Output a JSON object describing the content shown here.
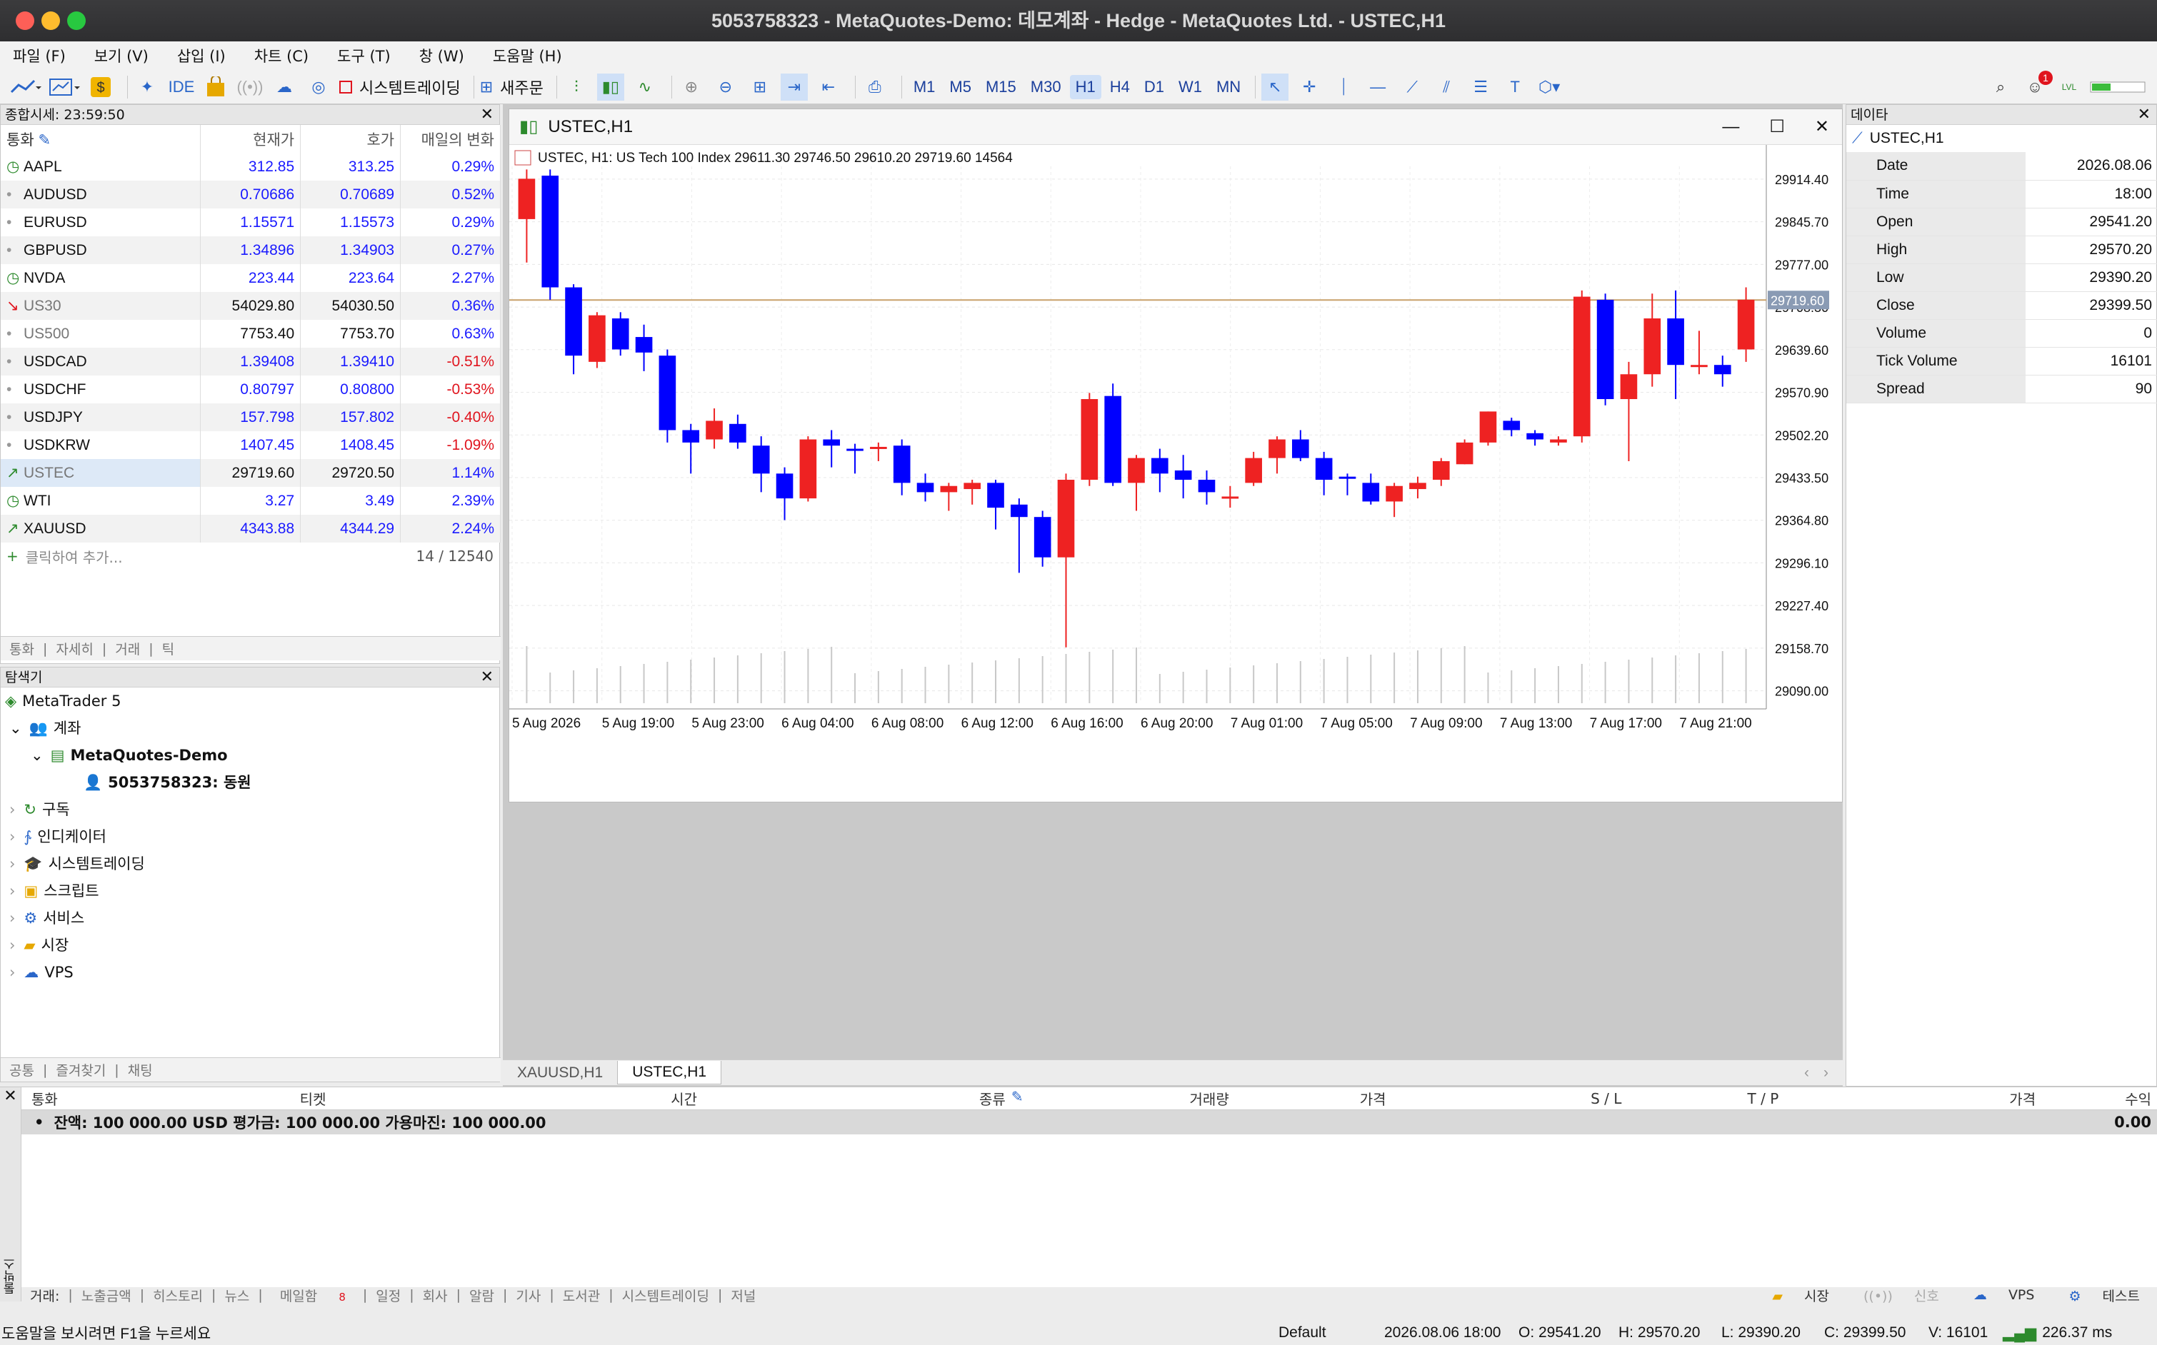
{
  "title": "5053758323 - MetaQuotes-Demo: 데모계좌 - Hedge - MetaQuotes Ltd. - USTEC,H1",
  "menu": [
    "파일 (F)",
    "보기 (V)",
    "삽입 (I)",
    "차트 (C)",
    "도구 (T)",
    "창 (W)",
    "도움말 (H)"
  ],
  "toolbar": {
    "algo": "시스템트레이딩",
    "new_order": "새주문",
    "ide": "IDE",
    "timeframes": [
      "M1",
      "M5",
      "M15",
      "M30",
      "H1",
      "H4",
      "D1",
      "W1",
      "MN"
    ],
    "active_tf": "H1",
    "badge": "1",
    "lvl": "LVL"
  },
  "market_watch": {
    "title": "종합시세: 23:59:50",
    "cols": [
      "통화",
      "현재가",
      "호가",
      "매일의 변화"
    ],
    "rows": [
      {
        "sym": "AAPL",
        "bid": "312.85",
        "ask": "313.25",
        "chg": "0.29%",
        "neg": false,
        "icon": "clock-icon",
        "dim": false
      },
      {
        "sym": "AUDUSD",
        "bid": "0.70686",
        "ask": "0.70689",
        "chg": "0.52%",
        "neg": false,
        "icon": "dot-icon",
        "dim": false
      },
      {
        "sym": "EURUSD",
        "bid": "1.15571",
        "ask": "1.15573",
        "chg": "0.29%",
        "neg": false,
        "icon": "dot-icon",
        "dim": false
      },
      {
        "sym": "GBPUSD",
        "bid": "1.34896",
        "ask": "1.34903",
        "chg": "0.27%",
        "neg": false,
        "icon": "dot-icon",
        "dim": false
      },
      {
        "sym": "NVDA",
        "bid": "223.44",
        "ask": "223.64",
        "chg": "2.27%",
        "neg": false,
        "icon": "clock-icon",
        "dim": false
      },
      {
        "sym": "US30",
        "bid": "54029.80",
        "ask": "54030.50",
        "chg": "0.36%",
        "neg": false,
        "icon": "arrow-down-icon",
        "dim": true
      },
      {
        "sym": "US500",
        "bid": "7753.40",
        "ask": "7753.70",
        "chg": "0.63%",
        "neg": false,
        "icon": "dot-icon",
        "dim": true
      },
      {
        "sym": "USDCAD",
        "bid": "1.39408",
        "ask": "1.39410",
        "chg": "-0.51%",
        "neg": true,
        "icon": "dot-icon",
        "dim": false
      },
      {
        "sym": "USDCHF",
        "bid": "0.80797",
        "ask": "0.80800",
        "chg": "-0.53%",
        "neg": true,
        "icon": "dot-icon",
        "dim": false
      },
      {
        "sym": "USDJPY",
        "bid": "157.798",
        "ask": "157.802",
        "chg": "-0.40%",
        "neg": true,
        "icon": "dot-icon",
        "dim": false
      },
      {
        "sym": "USDKRW",
        "bid": "1407.45",
        "ask": "1408.45",
        "chg": "-1.09%",
        "neg": true,
        "icon": "dot-icon",
        "dim": false
      },
      {
        "sym": "USTEC",
        "bid": "29719.60",
        "ask": "29720.50",
        "chg": "1.14%",
        "neg": false,
        "icon": "arrow-up-icon",
        "dim": true
      },
      {
        "sym": "WTI",
        "bid": "3.27",
        "ask": "3.49",
        "chg": "2.39%",
        "neg": false,
        "icon": "clock-icon",
        "dim": false
      },
      {
        "sym": "XAUUSD",
        "bid": "4343.88",
        "ask": "4344.29",
        "chg": "2.24%",
        "neg": false,
        "icon": "arrow-up-icon",
        "dim": false
      }
    ],
    "add_label": "클릭하여 추가...",
    "count": "14 / 12540",
    "tabs": [
      "통화",
      "자세히",
      "거래",
      "틱"
    ]
  },
  "navigator": {
    "title": "탐색기",
    "root": "MetaTrader 5",
    "accounts": "계좌",
    "server": "MetaQuotes-Demo",
    "account": "5053758323: 동원",
    "items": [
      "구독",
      "인디케이터",
      "시스템트레이딩",
      "스크립트",
      "서비스",
      "시장",
      "VPS"
    ],
    "tabs": [
      "공통",
      "즐겨찾기",
      "채팅"
    ]
  },
  "chart": {
    "window_title": "USTEC,H1",
    "info": "USTEC, H1:  US Tech 100 Index  29611.30 29746.50 29610.20 29719.60  14564",
    "current_price": "29719.60",
    "tabs": [
      "XAUUSD,H1",
      "USTEC,H1"
    ],
    "active_tab": "USTEC,H1"
  },
  "chart_data": {
    "type": "candlestick",
    "title": "USTEC, H1",
    "y_ticks": [
      "29914.40",
      "29845.70",
      "29777.00",
      "29708.30",
      "29639.60",
      "29570.90",
      "29502.20",
      "29433.50",
      "29364.80",
      "29296.10",
      "29227.40",
      "29158.70",
      "29090.00"
    ],
    "ylim": [
      29070,
      29935
    ],
    "x_ticks": [
      "5 Aug 2026",
      "5 Aug 19:00",
      "5 Aug 23:00",
      "6 Aug 04:00",
      "6 Aug 08:00",
      "6 Aug 12:00",
      "6 Aug 16:00",
      "6 Aug 20:00",
      "7 Aug 01:00",
      "7 Aug 05:00",
      "7 Aug 09:00",
      "7 Aug 13:00",
      "7 Aug 17:00",
      "7 Aug 21:00"
    ],
    "candles": [
      [
        29850,
        29915,
        29780,
        29930
      ],
      [
        29920,
        29740,
        29720,
        29930
      ],
      [
        29740,
        29630,
        29600,
        29745
      ],
      [
        29620,
        29695,
        29610,
        29700
      ],
      [
        29690,
        29640,
        29630,
        29700
      ],
      [
        29660,
        29635,
        29605,
        29680
      ],
      [
        29630,
        29510,
        29490,
        29640
      ],
      [
        29510,
        29490,
        29440,
        29520
      ],
      [
        29495,
        29525,
        29480,
        29545
      ],
      [
        29520,
        29490,
        29480,
        29535
      ],
      [
        29485,
        29440,
        29410,
        29500
      ],
      [
        29440,
        29400,
        29365,
        29450
      ],
      [
        29400,
        29495,
        29395,
        29500
      ],
      [
        29495,
        29485,
        29450,
        29510
      ],
      [
        29480,
        29478,
        29440,
        29488
      ],
      [
        29483,
        29483,
        29460,
        29490
      ],
      [
        29485,
        29425,
        29405,
        29495
      ],
      [
        29425,
        29410,
        29395,
        29440
      ],
      [
        29410,
        29420,
        29380,
        29425
      ],
      [
        29415,
        29425,
        29390,
        29430
      ],
      [
        29425,
        29385,
        29350,
        29430
      ],
      [
        29390,
        29370,
        29280,
        29400
      ],
      [
        29370,
        29305,
        29290,
        29380
      ],
      [
        29305,
        29430,
        29160,
        29440
      ],
      [
        29430,
        29560,
        29420,
        29570
      ],
      [
        29565,
        29425,
        29420,
        29585
      ],
      [
        29425,
        29465,
        29380,
        29470
      ],
      [
        29465,
        29440,
        29410,
        29480
      ],
      [
        29445,
        29430,
        29400,
        29470
      ],
      [
        29430,
        29410,
        29390,
        29445
      ],
      [
        29403,
        29403,
        29385,
        29420
      ],
      [
        29425,
        29465,
        29420,
        29475
      ],
      [
        29465,
        29495,
        29440,
        29500
      ],
      [
        29495,
        29465,
        29460,
        29510
      ],
      [
        29465,
        29430,
        29405,
        29475
      ],
      [
        29435,
        29433,
        29405,
        29440
      ],
      [
        29425,
        29395,
        29390,
        29440
      ],
      [
        29395,
        29420,
        29370,
        29425
      ],
      [
        29415,
        29425,
        29400,
        29435
      ],
      [
        29430,
        29460,
        29420,
        29465
      ],
      [
        29455,
        29490,
        29455,
        29495
      ],
      [
        29490,
        29540,
        29485,
        29540
      ],
      [
        29525,
        29510,
        29500,
        29530
      ],
      [
        29505,
        29495,
        29485,
        29510
      ],
      [
        29490,
        29495,
        29485,
        29500
      ],
      [
        29500,
        29725,
        29490,
        29735
      ],
      [
        29720,
        29560,
        29550,
        29730
      ],
      [
        29560,
        29600,
        29460,
        29620
      ],
      [
        29600,
        29690,
        29580,
        29730
      ],
      [
        29690,
        29615,
        29560,
        29735
      ],
      [
        29615,
        29615,
        29600,
        29670
      ],
      [
        29615,
        29600,
        29580,
        29630
      ],
      [
        29640,
        29720,
        29620,
        29740
      ]
    ]
  },
  "data_window": {
    "title": "데이타",
    "symbol": "USTEC,H1",
    "rows": [
      [
        "Date",
        "2026.08.06"
      ],
      [
        "Time",
        "18:00"
      ],
      [
        "Open",
        "29541.20"
      ],
      [
        "High",
        "29570.20"
      ],
      [
        "Low",
        "29390.20"
      ],
      [
        "Close",
        "29399.50"
      ],
      [
        "Volume",
        "0"
      ],
      [
        "Tick Volume",
        "16101"
      ],
      [
        "Spread",
        "90"
      ]
    ]
  },
  "toolbox": {
    "cols": [
      "통화",
      "티켓",
      "시간",
      "종류",
      "거래량",
      "가격",
      "S / L",
      "T / P",
      "가격",
      "수익"
    ],
    "balance": "잔액: 100 000.00 USD  평가금: 100 000.00  가용마진: 100 000.00",
    "profit": "0.00",
    "side_label": "툴박스",
    "tabs": [
      "거래:",
      "노출금액",
      "히스토리",
      "뉴스",
      "메일함",
      "일정",
      "회사",
      "알람",
      "기사",
      "도서관",
      "시스템트레이딩",
      "저널"
    ],
    "mail_count": "8",
    "right": [
      "시장",
      "신호",
      "VPS",
      "테스트"
    ]
  },
  "status": {
    "help": "도움말을 보시려면 F1을 누르세요",
    "profile": "Default",
    "datetime": "2026.08.06 18:00",
    "o": "O: 29541.20",
    "h": "H: 29570.20",
    "l": "L: 29390.20",
    "c": "C: 29399.50",
    "v": "V: 16101",
    "ping": "226.37 ms"
  },
  "colors": {
    "bull": "#0000ff",
    "bear": "#ee2222",
    "accent": "#2a66c9"
  }
}
